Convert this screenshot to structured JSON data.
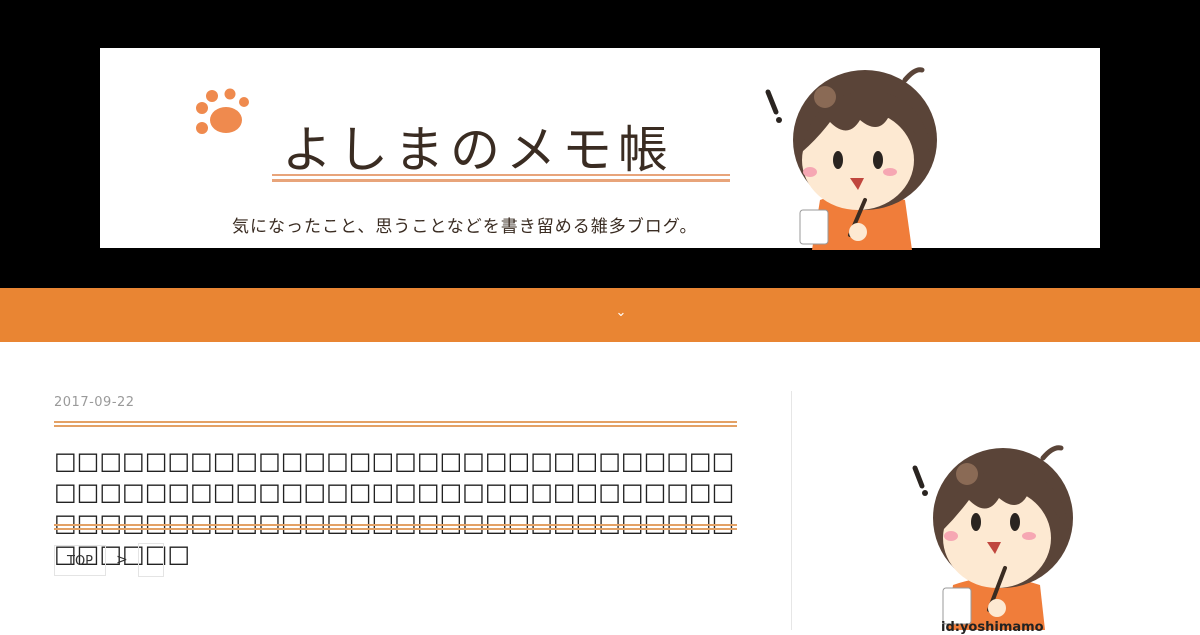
{
  "header": {
    "title": "よしまのメモ帳",
    "tagline": "気になったこと、思うことなどを書き留める雑多ブログ。"
  },
  "nav": {
    "toggle_icon": "chevron-down-icon",
    "toggle_glyph": "⌄",
    "bar_color": "#e98533"
  },
  "post": {
    "date": "2017-09-22",
    "title": "□□□□□□□□□□□□□□□□□□□□□□□□□□□□□□□□□□□□□□□□□□□□□□□□□□□□□□□□□□□□□□□□□□□□□□□□□□□□□□□□□□□□□□□□□□□□□□□□",
    "accent_color": "#e3a165"
  },
  "breadcrumb": {
    "top_label": "TOP",
    "separator": ">",
    "current_label": ""
  },
  "sidebar": {
    "profile_id": "id:yoshimamo"
  },
  "colors": {
    "header_bg": "#000000",
    "brand_orange": "#e98533",
    "text_dark": "#3a2c22"
  }
}
